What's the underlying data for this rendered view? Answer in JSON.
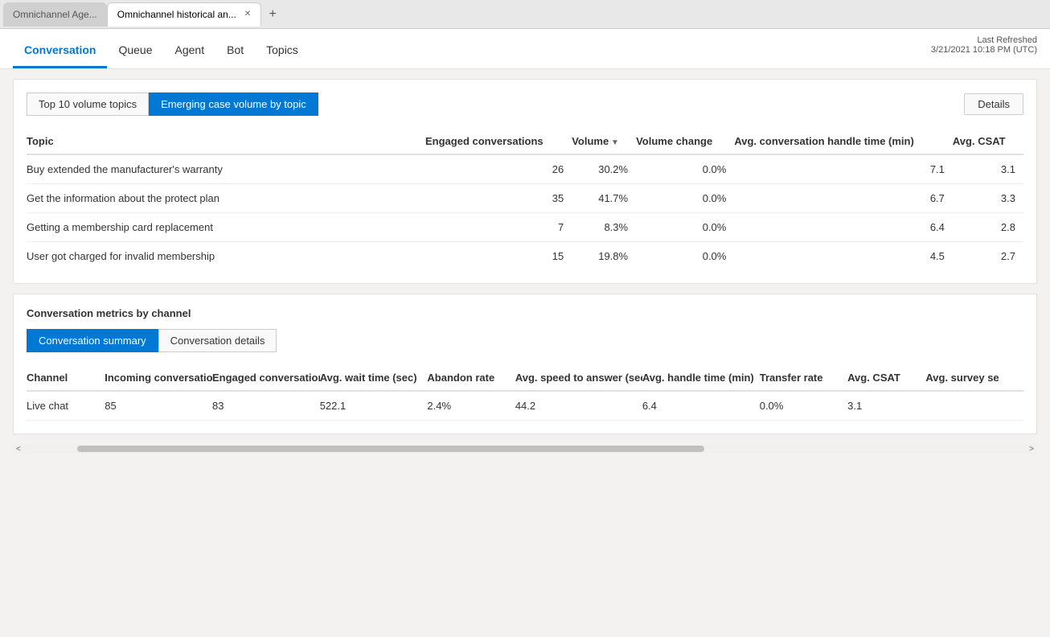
{
  "browser": {
    "tabs": [
      {
        "id": "tab1",
        "label": "Omnichannel Age...",
        "active": false
      },
      {
        "id": "tab2",
        "label": "Omnichannel historical an...",
        "active": true
      }
    ],
    "add_tab_label": "+"
  },
  "nav": {
    "items": [
      {
        "id": "conversation",
        "label": "Conversation",
        "active": true
      },
      {
        "id": "queue",
        "label": "Queue",
        "active": false
      },
      {
        "id": "agent",
        "label": "Agent",
        "active": false
      },
      {
        "id": "bot",
        "label": "Bot",
        "active": false
      },
      {
        "id": "topics",
        "label": "Topics",
        "active": false
      }
    ],
    "last_refreshed_label": "Last Refreshed",
    "last_refreshed_value": "3/21/2021 10:18 PM (UTC)"
  },
  "topics_panel": {
    "tab1_label": "Top 10 volume topics",
    "tab2_label": "Emerging case volume by topic",
    "details_label": "Details",
    "table": {
      "columns": [
        {
          "id": "topic",
          "label": "Topic",
          "sortable": false
        },
        {
          "id": "engaged",
          "label": "Engaged conversations",
          "sortable": false
        },
        {
          "id": "volume",
          "label": "Volume",
          "sortable": true
        },
        {
          "id": "volume_change",
          "label": "Volume change",
          "sortable": false
        },
        {
          "id": "avg_handle",
          "label": "Avg. conversation handle time (min)",
          "sortable": false
        },
        {
          "id": "avg_csat",
          "label": "Avg. CSAT",
          "sortable": false
        }
      ],
      "rows": [
        {
          "topic": "Buy extended the manufacturer's warranty",
          "engaged": "26",
          "volume": "30.2%",
          "volume_change": "0.0%",
          "avg_handle": "7.1",
          "avg_csat": "3.1"
        },
        {
          "topic": "Get the information about the protect plan",
          "engaged": "35",
          "volume": "41.7%",
          "volume_change": "0.0%",
          "avg_handle": "6.7",
          "avg_csat": "3.3"
        },
        {
          "topic": "Getting a membership card replacement",
          "engaged": "7",
          "volume": "8.3%",
          "volume_change": "0.0%",
          "avg_handle": "6.4",
          "avg_csat": "2.8"
        },
        {
          "topic": "User got charged for invalid membership",
          "engaged": "15",
          "volume": "19.8%",
          "volume_change": "0.0%",
          "avg_handle": "4.5",
          "avg_csat": "2.7"
        }
      ]
    }
  },
  "metrics_panel": {
    "section_label": "Conversation metrics by channel",
    "tab1_label": "Conversation summary",
    "tab2_label": "Conversation details",
    "table": {
      "columns": [
        {
          "id": "channel",
          "label": "Channel",
          "sortable": false
        },
        {
          "id": "incoming",
          "label": "Incoming conversations",
          "sortable": false
        },
        {
          "id": "engaged",
          "label": "Engaged conversations",
          "sortable": true
        },
        {
          "id": "avg_wait",
          "label": "Avg. wait time (sec)",
          "sortable": false
        },
        {
          "id": "abandon",
          "label": "Abandon rate",
          "sortable": false
        },
        {
          "id": "avg_speed",
          "label": "Avg. speed to answer (sec)",
          "sortable": false
        },
        {
          "id": "avg_handle",
          "label": "Avg. handle time (min)",
          "sortable": false
        },
        {
          "id": "transfer_rate",
          "label": "Transfer rate",
          "sortable": false
        },
        {
          "id": "avg_csat",
          "label": "Avg. CSAT",
          "sortable": false
        },
        {
          "id": "avg_survey",
          "label": "Avg. survey se",
          "sortable": false
        }
      ],
      "rows": [
        {
          "channel": "Live chat",
          "incoming": "85",
          "engaged": "83",
          "avg_wait": "522.1",
          "abandon": "2.4%",
          "avg_speed": "44.2",
          "avg_handle": "6.4",
          "transfer_rate": "0.0%",
          "avg_csat": "3.1",
          "avg_survey": ""
        }
      ]
    }
  }
}
